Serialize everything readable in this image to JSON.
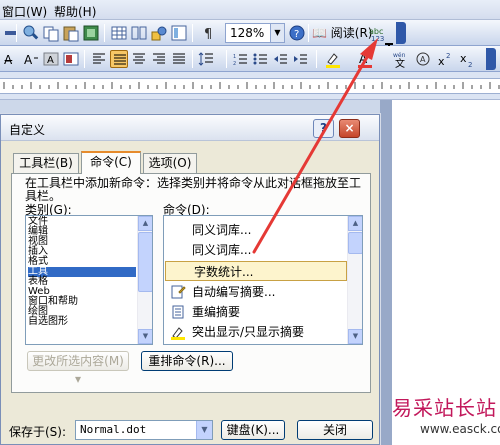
{
  "menubar": {
    "items": [
      {
        "label": "窗口(W)"
      },
      {
        "label": "帮助(H)"
      }
    ]
  },
  "toolbar": {
    "zoom": "128%",
    "read_label": "阅读(R)"
  },
  "dialog": {
    "title": "自定义",
    "help_glyph": "?",
    "close_glyph": "×",
    "tabs": [
      {
        "label": "工具栏(B)"
      },
      {
        "label": "命令(C)"
      },
      {
        "label": "选项(O)"
      }
    ],
    "instruction": "在工具栏中添加新命令：选择类别并将命令从此对话框拖放至工具栏。",
    "category_label": "类别(G):",
    "commands_label": "命令(D):",
    "categories": [
      {
        "label": "文件"
      },
      {
        "label": "编辑"
      },
      {
        "label": "视图"
      },
      {
        "label": "插入"
      },
      {
        "label": "格式"
      },
      {
        "label": "工具"
      },
      {
        "label": "表格"
      },
      {
        "label": "Web"
      },
      {
        "label": "窗口和帮助"
      },
      {
        "label": "绘图"
      },
      {
        "label": "自选图形"
      }
    ],
    "selected_category": "工具",
    "commands": [
      {
        "label": "同义词库...",
        "icon": "none"
      },
      {
        "label": "同义词库...",
        "icon": "none"
      },
      {
        "label": "字数统计...",
        "icon": "none"
      },
      {
        "label": "自动编写摘要...",
        "icon": "auto-summarize-icon"
      },
      {
        "label": "重编摘要",
        "icon": "resummarize-icon"
      },
      {
        "label": "突出显示/只显示摘要",
        "icon": "highlight-summary-icon"
      }
    ],
    "selected_command": "字数统计...",
    "modify_selection_label": "更改所选内容(M) ▾",
    "rearrange_label": "重排命令(R)...",
    "save_in_label": "保存于(S):",
    "template_value": "Normal.dot",
    "keyboard_label": "键盘(K)...",
    "close_label": "关闭"
  },
  "watermark": {
    "text": "易采站长站",
    "url": "www.easck.com"
  },
  "colors": {
    "arrow": "#e53935",
    "selection": "#316ac5",
    "highlight_row": "#fdf4cd"
  }
}
